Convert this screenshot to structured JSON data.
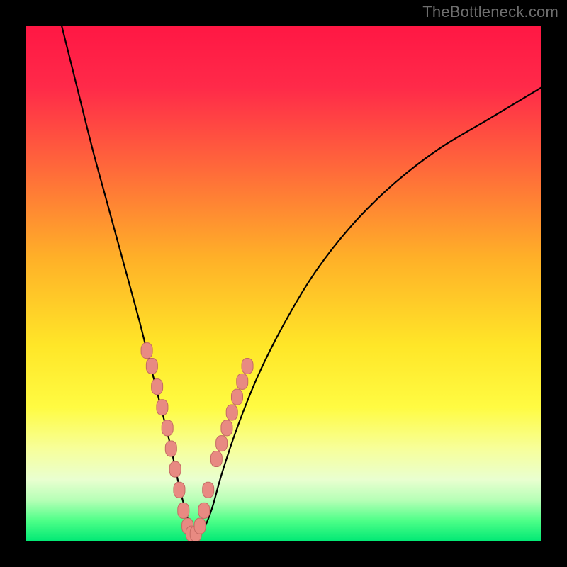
{
  "watermark": "TheBottleneck.com",
  "colors": {
    "frame": "#000000",
    "gradient_stops": [
      {
        "offset": "0%",
        "color": "#ff1744"
      },
      {
        "offset": "12%",
        "color": "#ff2a49"
      },
      {
        "offset": "28%",
        "color": "#ff6a3a"
      },
      {
        "offset": "45%",
        "color": "#ffb028"
      },
      {
        "offset": "62%",
        "color": "#ffe628"
      },
      {
        "offset": "74%",
        "color": "#fffb42"
      },
      {
        "offset": "82%",
        "color": "#f7ff9a"
      },
      {
        "offset": "88%",
        "color": "#e9ffd0"
      },
      {
        "offset": "92%",
        "color": "#b6ffb6"
      },
      {
        "offset": "96%",
        "color": "#4dff88"
      },
      {
        "offset": "100%",
        "color": "#00e874"
      }
    ],
    "curve": "#000000",
    "marker_fill": "#e88a82",
    "marker_stroke": "#c46a63"
  },
  "chart_data": {
    "type": "line",
    "title": "",
    "xlabel": "",
    "ylabel": "",
    "xlim": [
      0,
      100
    ],
    "ylim": [
      0,
      100
    ],
    "series": [
      {
        "name": "bottleneck-curve",
        "x": [
          7,
          10,
          13,
          16,
          19,
          22,
          24,
          26,
          28,
          29.5,
          31,
          32.5,
          34,
          36,
          38,
          41,
          45,
          50,
          56,
          63,
          71,
          80,
          90,
          100
        ],
        "y": [
          100,
          88,
          76,
          65,
          54,
          43,
          35,
          27,
          19,
          12,
          6,
          1.5,
          1.5,
          6,
          13,
          22,
          32,
          42,
          52,
          61,
          69,
          76,
          82,
          88
        ]
      }
    ],
    "markers": {
      "name": "highlight-points",
      "x": [
        23.5,
        24.5,
        25.5,
        26.5,
        27.5,
        28.2,
        29.0,
        29.8,
        30.6,
        31.4,
        32.2,
        33.0,
        33.8,
        34.6,
        35.4,
        37.0,
        38.0,
        39.0,
        40.0,
        41.0,
        42.0,
        43.0
      ],
      "y": [
        37,
        34,
        30,
        26,
        22,
        18,
        14,
        10,
        6,
        3,
        1.5,
        1.5,
        3,
        6,
        10,
        16,
        19,
        22,
        25,
        28,
        31,
        34
      ]
    }
  }
}
